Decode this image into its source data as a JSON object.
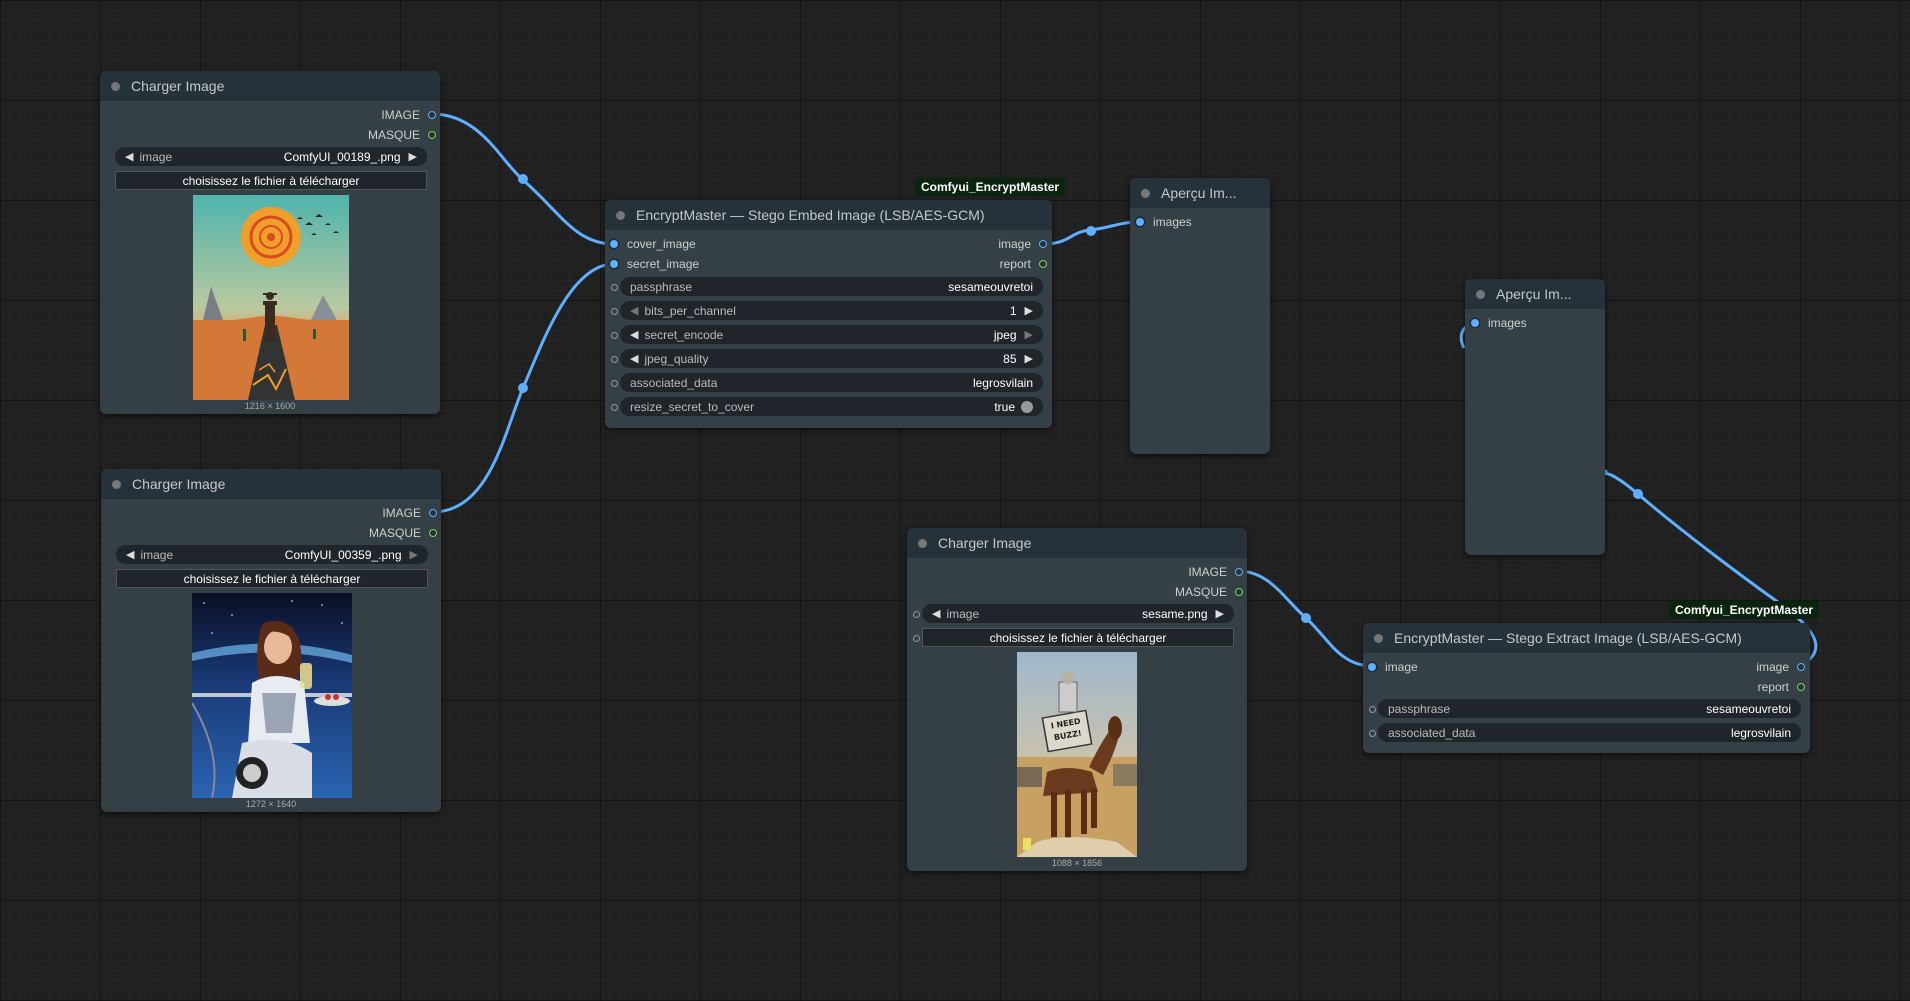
{
  "colors": {
    "image_wire": "#5eb0ff",
    "mask_socket": "#7fd650",
    "node_body": "#353f46",
    "node_header": "#26323a",
    "badge_bg": "#0b2410"
  },
  "load1": {
    "title": "Charger Image",
    "out_image": "IMAGE",
    "out_mask": "MASQUE",
    "image_label": "image",
    "image_value": "ComfyUI_00189_.png",
    "upload": "choisissez le fichier à télécharger",
    "dims": "1216 × 1600"
  },
  "load2": {
    "title": "Charger Image",
    "out_image": "IMAGE",
    "out_mask": "MASQUE",
    "image_label": "image",
    "image_value": "ComfyUI_00359_.png",
    "upload": "choisissez le fichier à télécharger",
    "dims": "1272 × 1640"
  },
  "load3": {
    "title": "Charger Image",
    "out_image": "IMAGE",
    "out_mask": "MASQUE",
    "image_label": "image",
    "image_value": "sesame.png",
    "upload": "choisissez le fichier à télécharger",
    "dims": "1088 × 1856",
    "sign_text": "I NEED BUZZ!"
  },
  "embed": {
    "badge": "Comfyui_EncryptMaster",
    "title": "EncryptMaster — Stego Embed Image (LSB/AES-GCM)",
    "in_cover": "cover_image",
    "in_secret": "secret_image",
    "out_image": "image",
    "out_report": "report",
    "widgets": {
      "passphrase_label": "passphrase",
      "passphrase_value": "sesameouvretoi",
      "bits_label": "bits_per_channel",
      "bits_value": "1",
      "encode_label": "secret_encode",
      "encode_value": "jpeg",
      "quality_label": "jpeg_quality",
      "quality_value": "85",
      "assoc_label": "associated_data",
      "assoc_value": "legrosvilain",
      "resize_label": "resize_secret_to_cover",
      "resize_value": "true"
    }
  },
  "preview1": {
    "title": "Aperçu Im...",
    "in_images": "images"
  },
  "preview2": {
    "title": "Aperçu Im...",
    "in_images": "images"
  },
  "extract": {
    "badge": "Comfyui_EncryptMaster",
    "title": "EncryptMaster — Stego Extract Image (LSB/AES-GCM)",
    "in_image": "image",
    "out_image": "image",
    "out_report": "report",
    "passphrase_label": "passphrase",
    "passphrase_value": "sesameouvretoi",
    "assoc_label": "associated_data",
    "assoc_value": "legrosvilain"
  }
}
